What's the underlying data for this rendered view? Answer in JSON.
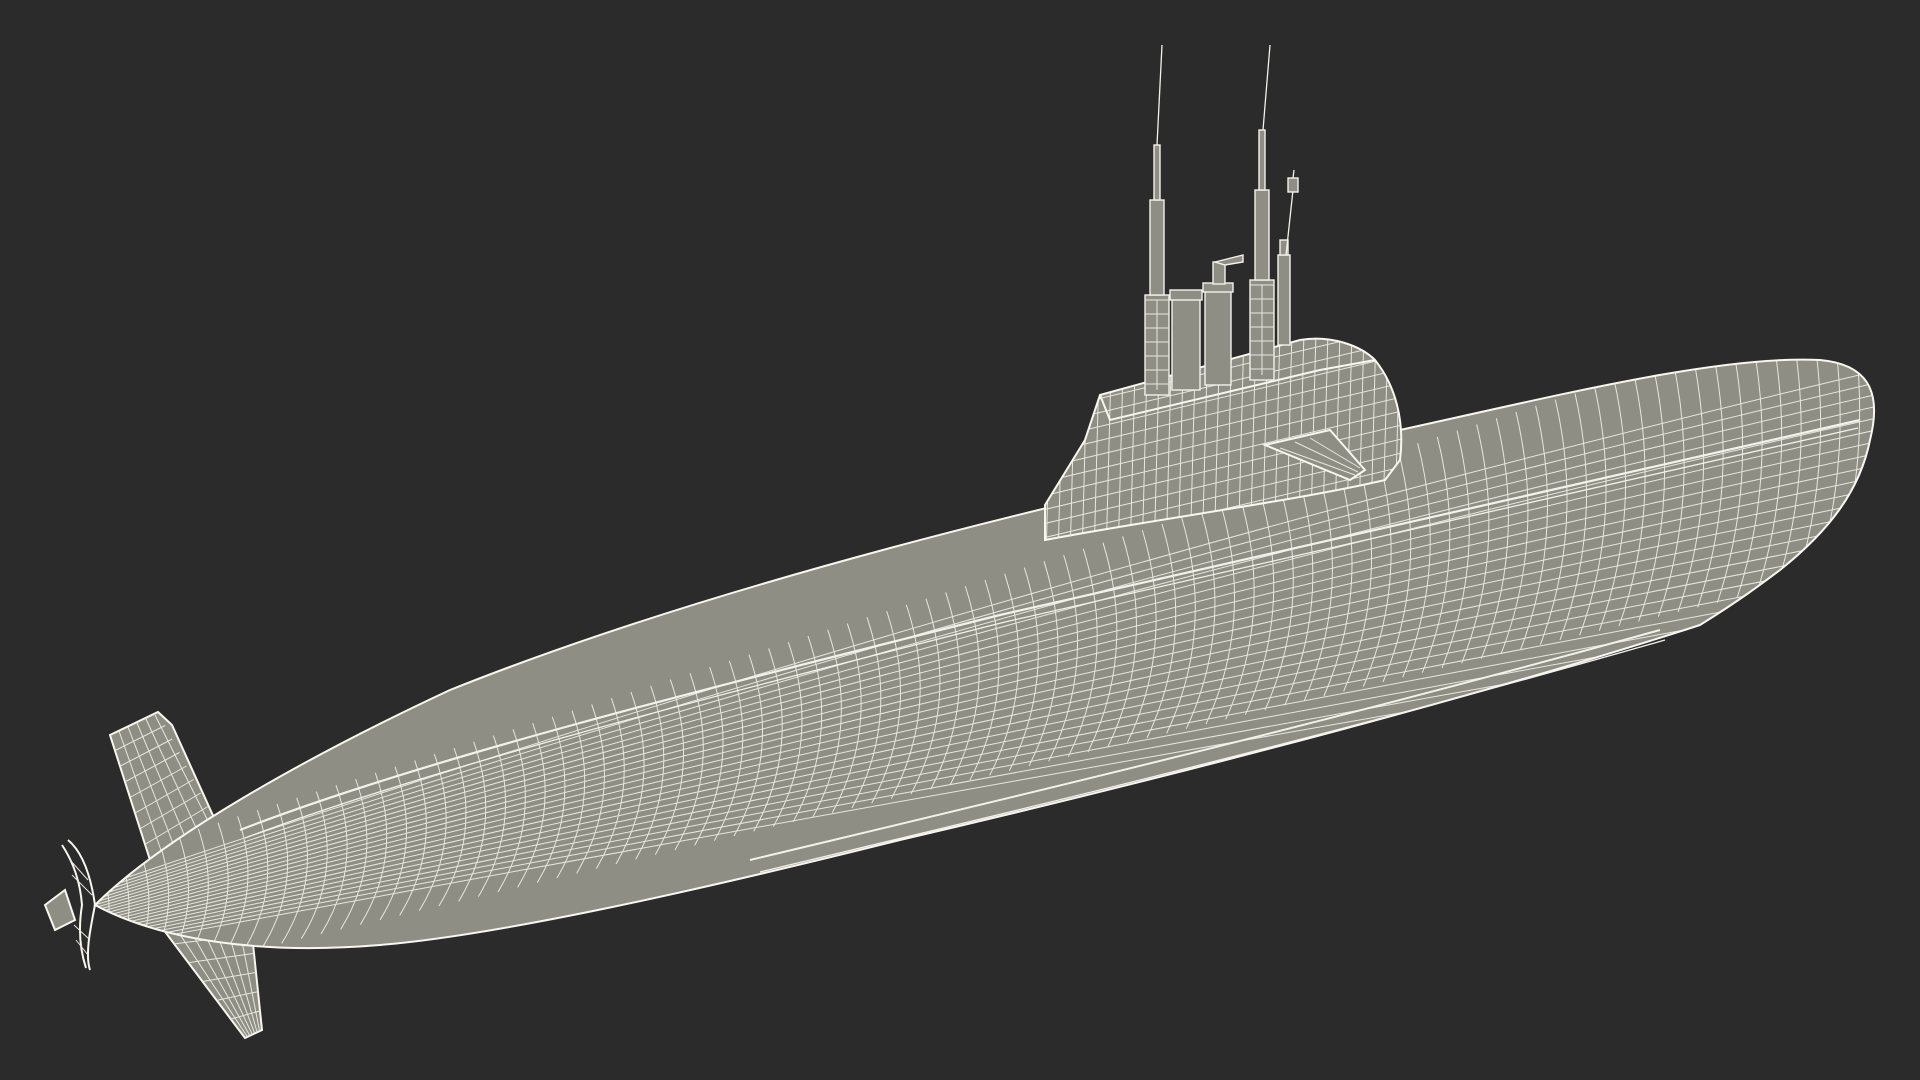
{
  "scene": {
    "subject": "submarine-wireframe-model",
    "colors": {
      "background": "#2b2b2b",
      "surface": "#8f8e84",
      "wire": "#f2f1ea"
    }
  }
}
